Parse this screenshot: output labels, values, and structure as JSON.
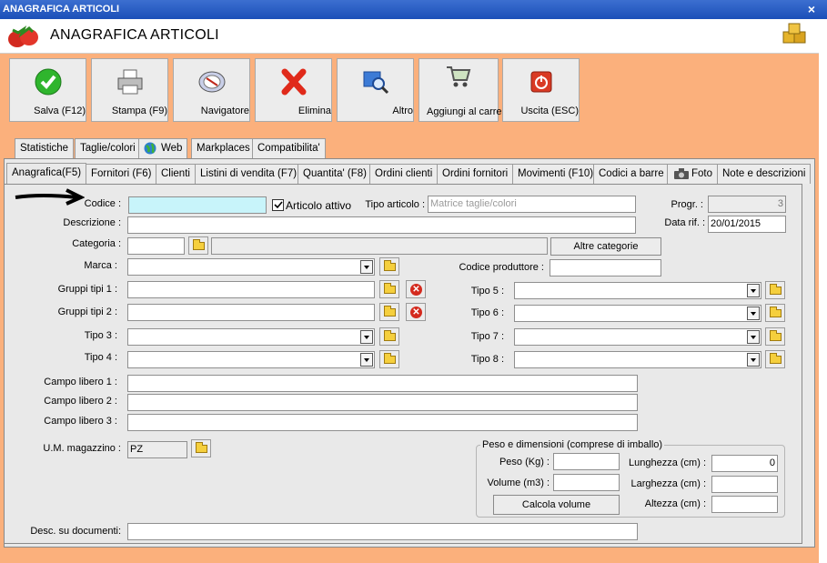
{
  "window": {
    "title": "ANAGRAFICA ARTICOLI",
    "close": "×"
  },
  "header": {
    "title": "ANAGRAFICA ARTICOLI"
  },
  "toolbar": [
    {
      "label": "Salva (F12)"
    },
    {
      "label": "Stampa (F9)"
    },
    {
      "label": "Navigatore"
    },
    {
      "label": "Elimina"
    },
    {
      "label": "Altro"
    },
    {
      "label": "Aggiungi al carrello"
    },
    {
      "label": "Uscita (ESC)"
    }
  ],
  "tabs_top": [
    "Statistiche",
    "Taglie/colori",
    "Web",
    "Markplaces",
    "Compatibilita'"
  ],
  "tabs_main": [
    "Anagrafica(F5)",
    "Fornitori (F6)",
    "Clienti",
    "Listini di vendita (F7)",
    "Quantita' (F8)",
    "Ordini clienti",
    "Ordini fornitori",
    "Movimenti (F10)",
    "Codici a barre",
    "Foto",
    "Note e descrizioni"
  ],
  "form": {
    "codice_label": "Codice :",
    "codice_value": "",
    "articolo_attivo": "Articolo attivo",
    "tipo_articolo_label": "Tipo articolo :",
    "tipo_articolo_placeholder": "Matrice taglie/colori",
    "progr_label": "Progr. :",
    "progr_value": "3",
    "descrizione_label": "Descrizione :",
    "data_rif_label": "Data rif. :",
    "data_rif_value": "20/01/2015",
    "categoria_label": "Categoria :",
    "altre_categorie": "Altre categorie",
    "marca_label": "Marca :",
    "codice_produttore_label": "Codice produttore :",
    "gruppi1_label": "Gruppi tipi 1 :",
    "gruppi2_label": "Gruppi tipi 2 :",
    "tipo3_label": "Tipo 3 :",
    "tipo4_label": "Tipo 4 :",
    "tipo5_label": "Tipo 5 :",
    "tipo6_label": "Tipo 6 :",
    "tipo7_label": "Tipo 7 :",
    "tipo8_label": "Tipo 8 :",
    "campo1_label": "Campo libero 1 :",
    "campo2_label": "Campo libero 2 :",
    "campo3_label": "Campo libero 3 :",
    "um_label": "U.M. magazzino :",
    "um_value": "PZ",
    "desc_doc_label": "Desc. su documenti:",
    "peso_group_title": "Peso e dimensioni (comprese di imballo)",
    "peso_label": "Peso (Kg) :",
    "volume_label": "Volume (m3) :",
    "calcola_volume": "Calcola volume",
    "lunghezza_label": "Lunghezza (cm) :",
    "lunghezza_value": "0",
    "larghezza_label": "Larghezza (cm) :",
    "altezza_label": "Altezza (cm) :"
  },
  "colors": {
    "background": "#fbb07c",
    "codice_field": "#c8f4fa",
    "titlebar": "#1b4fb8"
  }
}
